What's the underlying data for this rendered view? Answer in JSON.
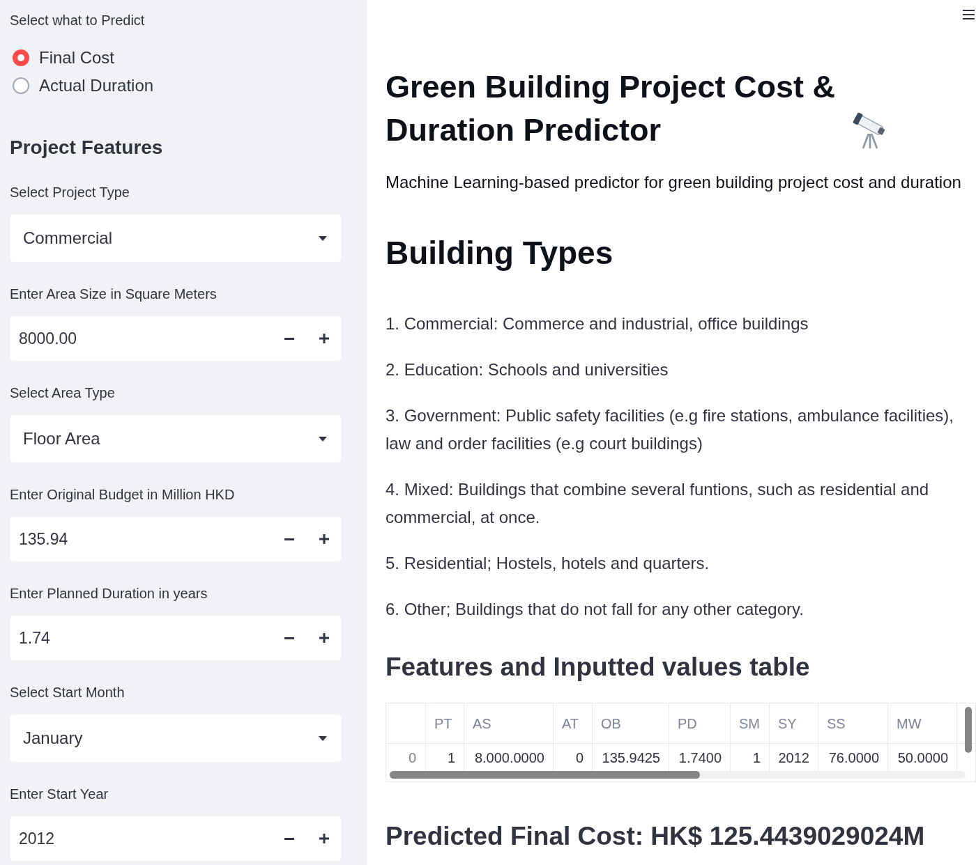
{
  "sidebar": {
    "predict_label": "Select what to Predict",
    "predict_options": [
      {
        "label": "Final Cost",
        "selected": true
      },
      {
        "label": "Actual Duration",
        "selected": false
      }
    ],
    "section_title": "Project Features",
    "fields": [
      {
        "kind": "select",
        "label": "Select Project Type",
        "value": "Commercial"
      },
      {
        "kind": "number",
        "label": "Enter Area Size in Square Meters",
        "value": "8000.00"
      },
      {
        "kind": "select",
        "label": "Select Area Type",
        "value": "Floor Area"
      },
      {
        "kind": "number",
        "label": "Enter Original Budget in Million HKD",
        "value": "135.94"
      },
      {
        "kind": "number",
        "label": "Enter Planned Duration in years",
        "value": "1.74"
      },
      {
        "kind": "select",
        "label": "Select Start Month",
        "value": "January"
      },
      {
        "kind": "number",
        "label": "Enter Start Year",
        "value": "2012"
      }
    ]
  },
  "main": {
    "title": "Green Building Project Cost & Duration Predictor",
    "subtitle": "Machine Learning-based predictor for green building project cost and duration",
    "building_types": {
      "heading": "Building Types",
      "items": [
        "1. Commercial: Commerce and industrial, office buildings",
        "2. Education: Schools and universities",
        "3. Government: Public safety facilities (e.g fire stations, ambulance facilities), law and order facilities (e.g court buildings)",
        "4. Mixed: Buildings that combine several funtions, such as residential and commercial, at once.",
        "5. Residential; Hostels, hotels and quarters.",
        "6. Other; Buildings that do not fall for any other category."
      ]
    },
    "features_table": {
      "heading": "Features and Inputted values table",
      "columns": [
        "PT",
        "AS",
        "AT",
        "OB",
        "PD",
        "SM",
        "SY",
        "SS",
        "MW"
      ],
      "rows": [
        {
          "index": "0",
          "cells": [
            "1",
            "8.000.0000",
            "0",
            "135.9425",
            "1.7400",
            "1",
            "2012",
            "76.0000",
            "50.0000"
          ]
        }
      ]
    },
    "prediction": "Predicted Final Cost: HK$ 125.4439029024M"
  }
}
